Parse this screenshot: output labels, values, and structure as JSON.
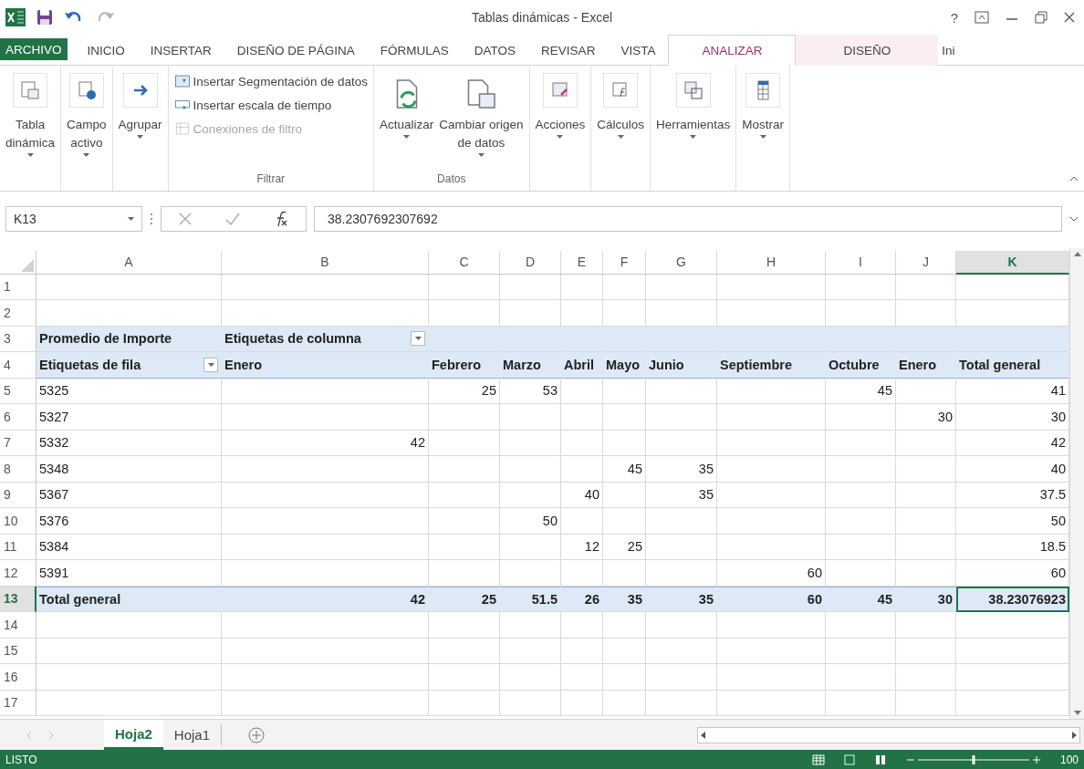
{
  "window": {
    "title": "Tablas dinámicas - Excel",
    "help": "?"
  },
  "tabs": [
    {
      "label": "ARCHIVO",
      "kind": "file",
      "selected": false
    },
    {
      "label": "INICIO",
      "kind": "normal",
      "selected": false
    },
    {
      "label": "INSERTAR",
      "kind": "normal",
      "selected": false
    },
    {
      "label": "DISEÑO DE PÁGINA",
      "kind": "normal",
      "selected": false
    },
    {
      "label": "FÓRMULAS",
      "kind": "normal",
      "selected": false
    },
    {
      "label": "DATOS",
      "kind": "normal",
      "selected": false
    },
    {
      "label": "REVISAR",
      "kind": "normal",
      "selected": false
    },
    {
      "label": "VISTA",
      "kind": "normal",
      "selected": false
    },
    {
      "label": "ANALIZAR",
      "kind": "contextual",
      "selected": true
    },
    {
      "label": "DISEÑO",
      "kind": "contextual",
      "selected": false
    },
    {
      "label": "Ini",
      "kind": "account",
      "selected": false
    }
  ],
  "ribbon": [
    {
      "items": [
        {
          "kind": "large",
          "lines": [
            "Tabla",
            "dinámica"
          ],
          "dropdown": true
        }
      ]
    },
    {
      "items": [
        {
          "kind": "large",
          "lines": [
            "Campo",
            "activo"
          ],
          "dropdown": true
        }
      ]
    },
    {
      "items": [
        {
          "kind": "large",
          "lines": [
            "Agrupar"
          ],
          "dropdown": true
        }
      ]
    },
    {
      "label": "Filtrar",
      "items": [
        {
          "kind": "small",
          "lines": [
            "Insertar Segmentación de datos"
          ],
          "disabled": false
        },
        {
          "kind": "small",
          "lines": [
            "Insertar escala de tiempo"
          ],
          "disabled": false
        },
        {
          "kind": "small",
          "lines": [
            "Conexiones de filtro"
          ],
          "disabled": true
        }
      ]
    },
    {
      "label": "Datos",
      "items": [
        {
          "kind": "large",
          "lines": [
            "Actualizar"
          ],
          "dropdown": true
        },
        {
          "kind": "large",
          "lines": [
            "Cambiar origen",
            "de datos"
          ],
          "dropdown": true
        }
      ]
    },
    {
      "items": [
        {
          "kind": "large",
          "lines": [
            "Acciones"
          ],
          "dropdown": true
        }
      ]
    },
    {
      "items": [
        {
          "kind": "large",
          "lines": [
            "Cálculos"
          ],
          "dropdown": true
        }
      ]
    },
    {
      "items": [
        {
          "kind": "large",
          "lines": [
            "Herramientas"
          ],
          "dropdown": true
        }
      ]
    },
    {
      "items": [
        {
          "kind": "large",
          "lines": [
            "Mostrar"
          ],
          "dropdown": true
        }
      ]
    }
  ],
  "formula_bar": {
    "name_box": "K13",
    "formula": "38.2307692307692"
  },
  "columns": [
    {
      "label": "A",
      "selected": false
    },
    {
      "label": "B",
      "selected": false
    },
    {
      "label": "C",
      "selected": false
    },
    {
      "label": "D",
      "selected": false
    },
    {
      "label": "E",
      "selected": false
    },
    {
      "label": "F",
      "selected": false
    },
    {
      "label": "G",
      "selected": false
    },
    {
      "label": "H",
      "selected": false
    },
    {
      "label": "I",
      "selected": false
    },
    {
      "label": "J",
      "selected": false
    },
    {
      "label": "K",
      "selected": true
    }
  ],
  "rows": [
    {
      "header": "1",
      "kind": "blank",
      "selected": false,
      "cells": []
    },
    {
      "header": "2",
      "kind": "blank",
      "selected": false,
      "cells": []
    },
    {
      "header": "3",
      "kind": "pivot_header",
      "selected": false,
      "cells": [
        "Promedio de Importe",
        {
          "text": "Etiquetas de columna",
          "filter": true
        }
      ]
    },
    {
      "header": "4",
      "kind": "pivot_labels",
      "selected": false,
      "cells": [
        {
          "text": "Etiquetas de fila",
          "filter": true
        },
        "Enero",
        "Febrero",
        "Marzo",
        "Abril",
        "Mayo",
        "Junio",
        "Septiembre",
        "Octubre",
        "Enero",
        "Total general"
      ]
    },
    {
      "header": "5",
      "kind": "data",
      "selected": false,
      "cells": [
        "5325",
        "",
        "25",
        "53",
        "",
        "",
        "",
        "",
        "45",
        "",
        "41"
      ]
    },
    {
      "header": "6",
      "kind": "data",
      "selected": false,
      "cells": [
        "5327",
        "",
        "",
        "",
        "",
        "",
        "",
        "",
        "",
        "30",
        "30"
      ]
    },
    {
      "header": "7",
      "kind": "data",
      "selected": false,
      "cells": [
        "5332",
        "42",
        "",
        "",
        "",
        "",
        "",
        "",
        "",
        "",
        "42"
      ]
    },
    {
      "header": "8",
      "kind": "data",
      "selected": false,
      "cells": [
        "5348",
        "",
        "",
        "",
        "",
        "45",
        "35",
        "",
        "",
        "",
        "40"
      ]
    },
    {
      "header": "9",
      "kind": "data",
      "selected": false,
      "cells": [
        "5367",
        "",
        "",
        "",
        "40",
        "",
        "35",
        "",
        "",
        "",
        "37.5"
      ]
    },
    {
      "header": "10",
      "kind": "data",
      "selected": false,
      "cells": [
        "5376",
        "",
        "",
        "50",
        "",
        "",
        "",
        "",
        "",
        "",
        "50"
      ]
    },
    {
      "header": "11",
      "kind": "data",
      "selected": false,
      "cells": [
        "5384",
        "",
        "",
        "",
        "12",
        "25",
        "",
        "",
        "",
        "",
        "18.5"
      ]
    },
    {
      "header": "12",
      "kind": "data",
      "selected": false,
      "cells": [
        "5391",
        "",
        "",
        "",
        "",
        "",
        "",
        "60",
        "",
        "",
        "60"
      ]
    },
    {
      "header": "13",
      "kind": "total",
      "selected": true,
      "cells": [
        "Total general",
        "42",
        "25",
        "51.5",
        "26",
        "35",
        "35",
        "60",
        "45",
        "30",
        "38.23076923"
      ]
    },
    {
      "header": "14",
      "kind": "blank",
      "selected": false,
      "cells": []
    },
    {
      "header": "15",
      "kind": "blank",
      "selected": false,
      "cells": []
    },
    {
      "header": "16",
      "kind": "blank",
      "selected": false,
      "cells": []
    },
    {
      "header": "17",
      "kind": "blank",
      "selected": false,
      "cells": []
    }
  ],
  "sheets": [
    {
      "label": "Hoja2",
      "selected": true
    },
    {
      "label": "Hoja1",
      "selected": false
    }
  ],
  "status_bar": {
    "mode": "LISTO",
    "zoom": "100",
    "level": 0.5
  }
}
